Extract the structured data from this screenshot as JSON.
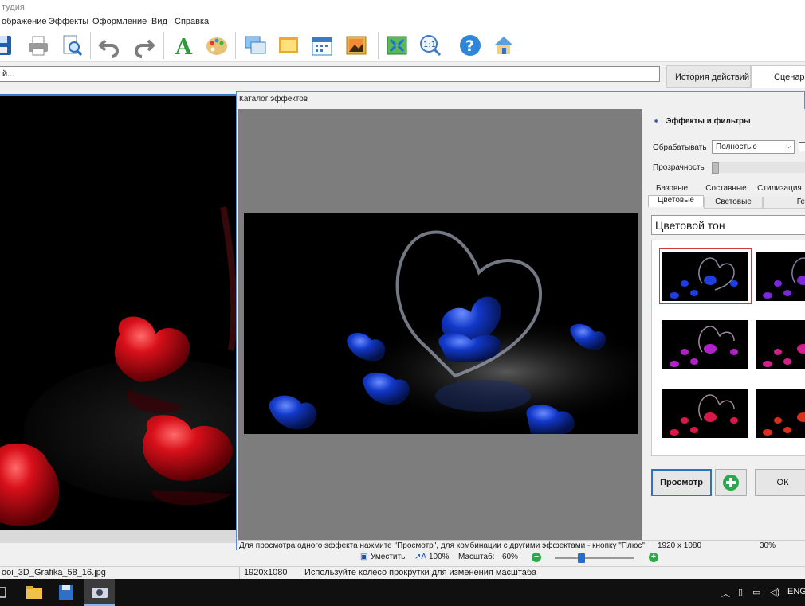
{
  "window": {
    "title": "тудия"
  },
  "menu": [
    "ображение",
    "Эффекты",
    "Оформление",
    "Вид",
    "Справка"
  ],
  "toolbar": {
    "icons": [
      "save-icon",
      "print-icon",
      "print-preview-icon",
      "undo-icon",
      "redo-icon",
      "text-icon",
      "palette-icon",
      "layers-icon",
      "frame-icon",
      "calendar-icon",
      "image-insert-icon",
      "fit-icon",
      "actual-size-icon",
      "help-icon",
      "home-icon"
    ]
  },
  "path_bar": {
    "value": "й..."
  },
  "side_tabs": {
    "history": "История действий",
    "script": "Сценари"
  },
  "dialog": {
    "title": "Каталог эффектов",
    "panel_title": "Эффекты и фильтры",
    "process_label": "Обрабатывать",
    "process_value": "Полностью",
    "opacity_label": "Прозрачность",
    "opacity_value": 0,
    "tabs_row1": [
      "Базовые",
      "Составные",
      "Стилизация"
    ],
    "tabs_row2": [
      "Цветовые",
      "Световые",
      "Ге"
    ],
    "active_tab": "Цветовые",
    "effect_select": "Цветовой тон",
    "buttons": {
      "preview": "Просмотр",
      "ok": "ОК"
    },
    "status": {
      "hint": "Для просмотра одного эффекта нажмите \"Просмотр\", для комбинации с другими эффектами - кнопку \"Плюс\"",
      "size": "1920 х 1080",
      "zoom": "30%"
    }
  },
  "zoom_bar": {
    "fit_label": "Уместить",
    "actual_label": "100%",
    "scale_label": "Масштаб:",
    "scale_value": "60%"
  },
  "status_bar": {
    "filename": "ooi_3D_Grafika_58_16.jpg",
    "dimensions": "1920x1080",
    "hint": "Используйте колесо прокрутки для изменения масштаба"
  },
  "taskbar": {
    "apps": [
      "task-view-icon",
      "explorer-icon",
      "save-app-icon",
      "photo-studio-icon"
    ],
    "tray_lang": "ENG"
  },
  "colors": {
    "accent": "#2f6fc6",
    "hearts_red": "#c8101a",
    "hearts_blue": "#1238c8"
  }
}
